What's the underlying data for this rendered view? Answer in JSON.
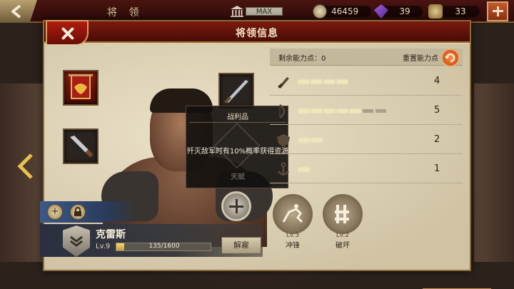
{
  "topbar": {
    "title": "将 领",
    "level_label": "MAX",
    "coins": "46459",
    "gems": "39",
    "food": "33"
  },
  "panel": {
    "title": "将领信息"
  },
  "stats": {
    "remaining_label": "剩余能力点：0",
    "reset_label": "重置能力点",
    "rows": [
      {
        "icon": "sword-icon",
        "value": "4",
        "filled": 4,
        "total": 4
      },
      {
        "icon": "bow-icon",
        "value": "5",
        "filled": 5,
        "total": 7
      },
      {
        "icon": "shield-icon",
        "value": "2",
        "filled": 2,
        "total": 2
      },
      {
        "icon": "anchor-icon",
        "value": "1",
        "filled": 1,
        "total": 1
      }
    ]
  },
  "tooltip": {
    "title": "战利品",
    "description": "歼灭敌军时有10%概率获得资源",
    "subtitle": "天赋"
  },
  "skills": [
    {
      "level": "Lv.3",
      "name": "冲锋",
      "icon": "cavalry-charge-icon"
    },
    {
      "level": "Lv.2",
      "name": "破坏",
      "icon": "ram-siege-icon"
    }
  ],
  "hero": {
    "name": "克雷斯",
    "level": "Lv.9",
    "xp_text": "135/1600",
    "xp_progress": 0.084,
    "dismiss_label": "解雇"
  },
  "colors": {
    "header_red": "#7a1a10",
    "panel_bg": "#d9cdb0",
    "accent_gold": "#d9a060"
  }
}
